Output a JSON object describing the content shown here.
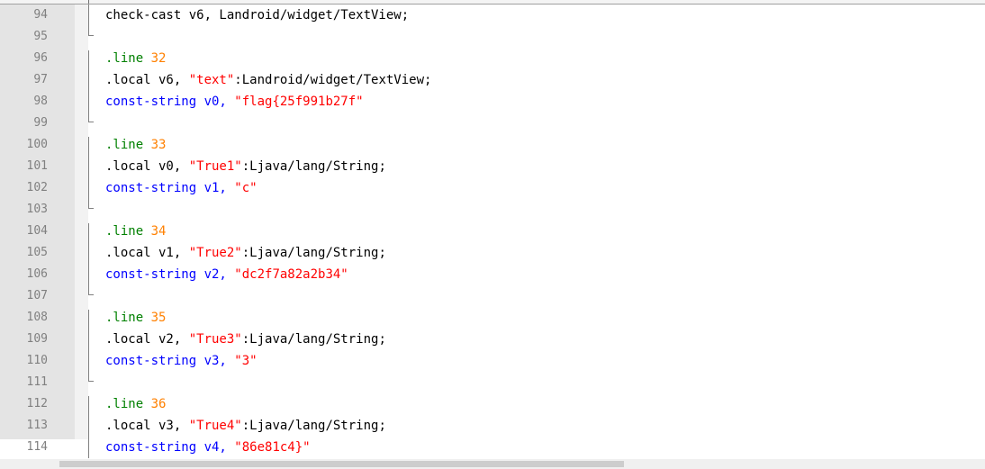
{
  "editor": {
    "lines": [
      {
        "num": "94",
        "tokens": [
          {
            "t": "check-cast v6, Landroid/widget/TextView;",
            "c": "plain"
          }
        ]
      },
      {
        "num": "95",
        "tokens": []
      },
      {
        "num": "96",
        "tokens": [
          {
            "t": ".line ",
            "c": "kw-green"
          },
          {
            "t": "32",
            "c": "num-orange"
          }
        ]
      },
      {
        "num": "97",
        "tokens": [
          {
            "t": ".local v6, ",
            "c": "plain"
          },
          {
            "t": "\"text\"",
            "c": "str-red"
          },
          {
            "t": ":Landroid/widget/TextView;",
            "c": "plain"
          }
        ]
      },
      {
        "num": "98",
        "tokens": [
          {
            "t": "const-string v0, ",
            "c": "kw-blue"
          },
          {
            "t": "\"flag{25f991b27f\"",
            "c": "str-red"
          }
        ]
      },
      {
        "num": "99",
        "tokens": []
      },
      {
        "num": "100",
        "tokens": [
          {
            "t": ".line ",
            "c": "kw-green"
          },
          {
            "t": "33",
            "c": "num-orange"
          }
        ]
      },
      {
        "num": "101",
        "tokens": [
          {
            "t": ".local v0, ",
            "c": "plain"
          },
          {
            "t": "\"True1\"",
            "c": "str-red"
          },
          {
            "t": ":Ljava/lang/String;",
            "c": "plain"
          }
        ]
      },
      {
        "num": "102",
        "tokens": [
          {
            "t": "const-string v1, ",
            "c": "kw-blue"
          },
          {
            "t": "\"c\"",
            "c": "str-red"
          }
        ]
      },
      {
        "num": "103",
        "tokens": []
      },
      {
        "num": "104",
        "tokens": [
          {
            "t": ".line ",
            "c": "kw-green"
          },
          {
            "t": "34",
            "c": "num-orange"
          }
        ]
      },
      {
        "num": "105",
        "tokens": [
          {
            "t": ".local v1, ",
            "c": "plain"
          },
          {
            "t": "\"True2\"",
            "c": "str-red"
          },
          {
            "t": ":Ljava/lang/String;",
            "c": "plain"
          }
        ]
      },
      {
        "num": "106",
        "tokens": [
          {
            "t": "const-string v2, ",
            "c": "kw-blue"
          },
          {
            "t": "\"dc2f7a82a2b34\"",
            "c": "str-red"
          }
        ]
      },
      {
        "num": "107",
        "tokens": []
      },
      {
        "num": "108",
        "tokens": [
          {
            "t": ".line ",
            "c": "kw-green"
          },
          {
            "t": "35",
            "c": "num-orange"
          }
        ]
      },
      {
        "num": "109",
        "tokens": [
          {
            "t": ".local v2, ",
            "c": "plain"
          },
          {
            "t": "\"True3\"",
            "c": "str-red"
          },
          {
            "t": ":Ljava/lang/String;",
            "c": "plain"
          }
        ]
      },
      {
        "num": "110",
        "tokens": [
          {
            "t": "const-string v3, ",
            "c": "kw-blue"
          },
          {
            "t": "\"3\"",
            "c": "str-red"
          }
        ]
      },
      {
        "num": "111",
        "tokens": []
      },
      {
        "num": "112",
        "tokens": [
          {
            "t": ".line ",
            "c": "kw-green"
          },
          {
            "t": "36",
            "c": "num-orange"
          }
        ]
      },
      {
        "num": "113",
        "tokens": [
          {
            "t": ".local v3, ",
            "c": "plain"
          },
          {
            "t": "\"True4\"",
            "c": "str-red"
          },
          {
            "t": ":Ljava/lang/String;",
            "c": "plain"
          }
        ]
      },
      {
        "num": "114",
        "tokens": [
          {
            "t": "const-string v4, ",
            "c": "kw-blue"
          },
          {
            "t": "\"86e81c4}\"",
            "c": "str-red"
          }
        ]
      }
    ],
    "colors": {
      "keyword_blue": "#0000ff",
      "directive_green": "#008000",
      "number_orange": "#ff8000",
      "string_red": "#ff0000",
      "gutter_bg": "#e4e4e4",
      "line_number": "#808080"
    }
  }
}
